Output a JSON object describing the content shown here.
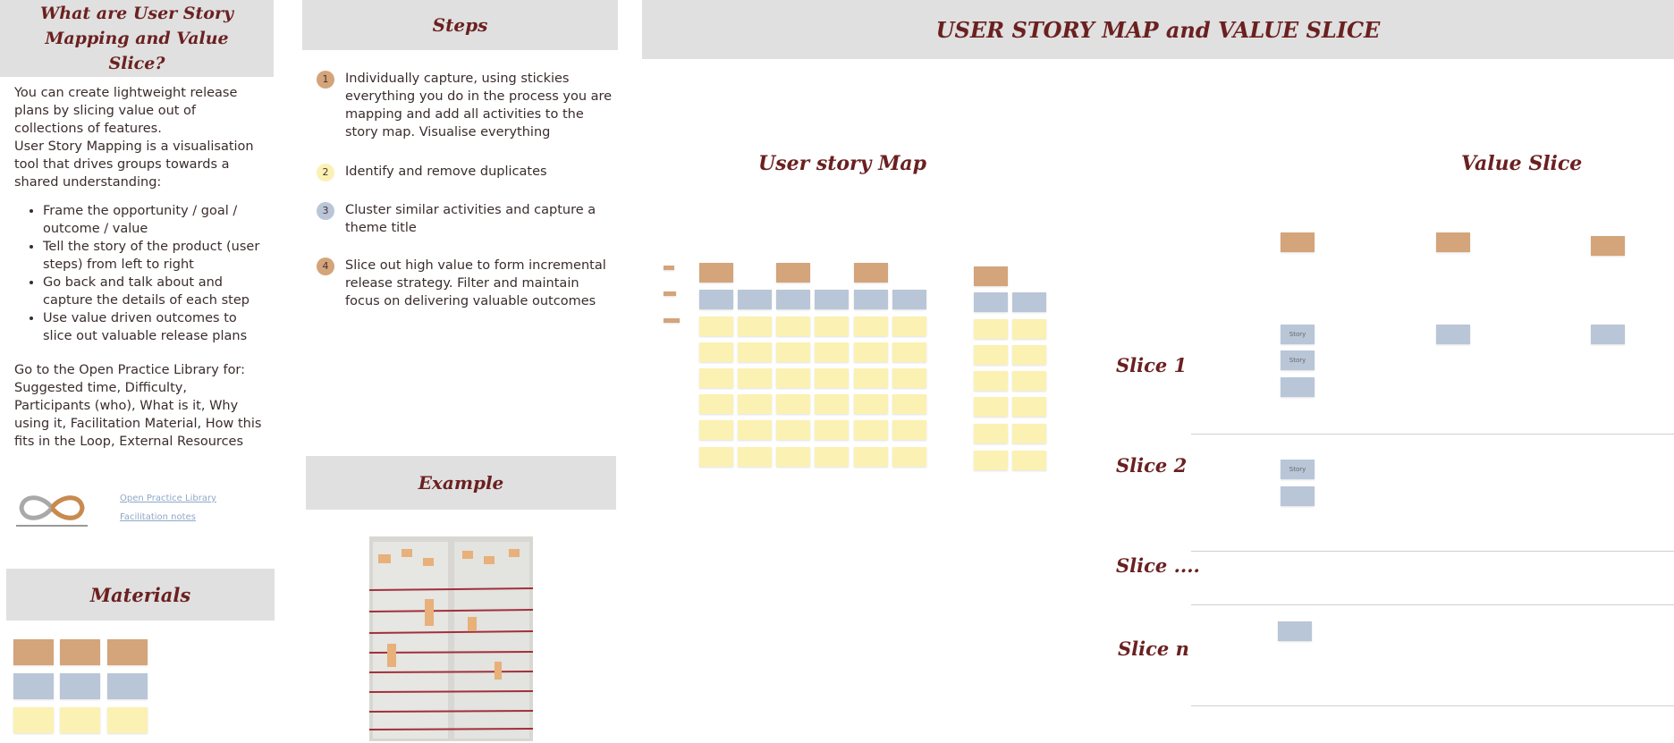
{
  "left": {
    "header": "What are User Story Mapping and Value Slice?",
    "intro1": "You can create lightweight release plans by slicing value out of collections of features.",
    "intro2": "User Story Mapping is a visualisation tool that drives groups towards a shared understanding:",
    "bullets": [
      "Frame the opportunity / goal / outcome / value",
      "Tell the story of the product (user steps) from left to right",
      "Go back and talk about and capture the details of each step",
      "Use value driven outcomes to slice out valuable release plans"
    ],
    "footer": "Go to the Open Practice Library for: Suggested time, Difficulty, Participants (who), What is it, Why using it, Facilitation Material, How this fits in the Loop, External Resources",
    "link1": "Open Practice Library",
    "link2": "Facilitation notes",
    "logo_icon": "infinity-loop-icon",
    "materials_header": "Materials"
  },
  "steps": {
    "header": "Steps",
    "items": [
      {
        "num": "1",
        "text": "Individually capture, using stickies everything you do in the process you are mapping and add all activities to the story map. Visualise everything",
        "color": "#d4a47a"
      },
      {
        "num": "2",
        "text": "Identify and remove duplicates",
        "color": "#fbf1b3"
      },
      {
        "num": "3",
        "text": "Cluster similar activities and capture a theme title",
        "color": "#b9c6d8"
      },
      {
        "num": "4",
        "text": "Slice out high value to form incremental release strategy. Filter and maintain focus on delivering valuable outcomes",
        "color": "#d4a47a"
      }
    ],
    "example_header": "Example"
  },
  "main": {
    "header": "USER STORY MAP and  VALUE SLICE",
    "map_title": "User story Map",
    "slice_title": "Value Slice",
    "slices": [
      "Slice 1",
      "Slice 2",
      "Slice ....",
      "Slice n"
    ],
    "story_label": "Story"
  },
  "colors": {
    "orange": "#d4a47a",
    "blue": "#b9c6d8",
    "yellow": "#fbf1b3",
    "title": "#6b2020",
    "header_bg": "#e0e0e0"
  }
}
